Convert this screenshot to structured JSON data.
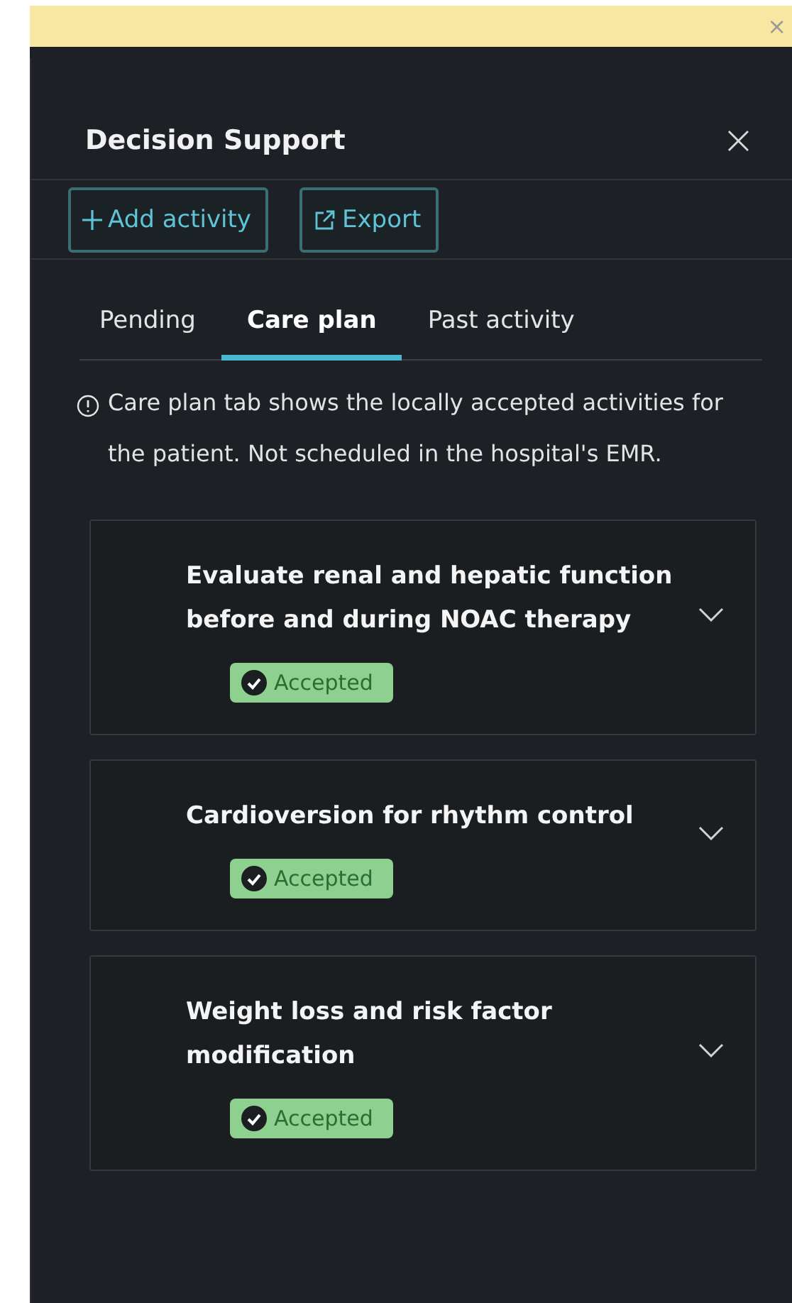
{
  "notice_bar": {
    "close": "×"
  },
  "panel": {
    "title": "Decision Support",
    "close": "×"
  },
  "toolbar": [
    {
      "kind": "add",
      "label": "Add activity"
    },
    {
      "kind": "export",
      "label": "Export"
    }
  ],
  "tabs": [
    {
      "label": "Pending",
      "selected": false
    },
    {
      "label": "Care plan",
      "selected": true
    },
    {
      "label": "Past activity",
      "selected": false
    }
  ],
  "info": "Care plan tab shows the locally accepted activities for the patient. Not scheduled in the hospital's EMR.",
  "activities": [
    {
      "title": "Evaluate renal and hepatic function before and during NOAC therapy",
      "status": "Accepted",
      "expanded": false
    },
    {
      "title": "Cardioversion for rhythm control",
      "status": "Accepted",
      "expanded": false
    },
    {
      "title": "Weight loss and risk factor modification",
      "status": "Accepted",
      "expanded": false
    }
  ]
}
